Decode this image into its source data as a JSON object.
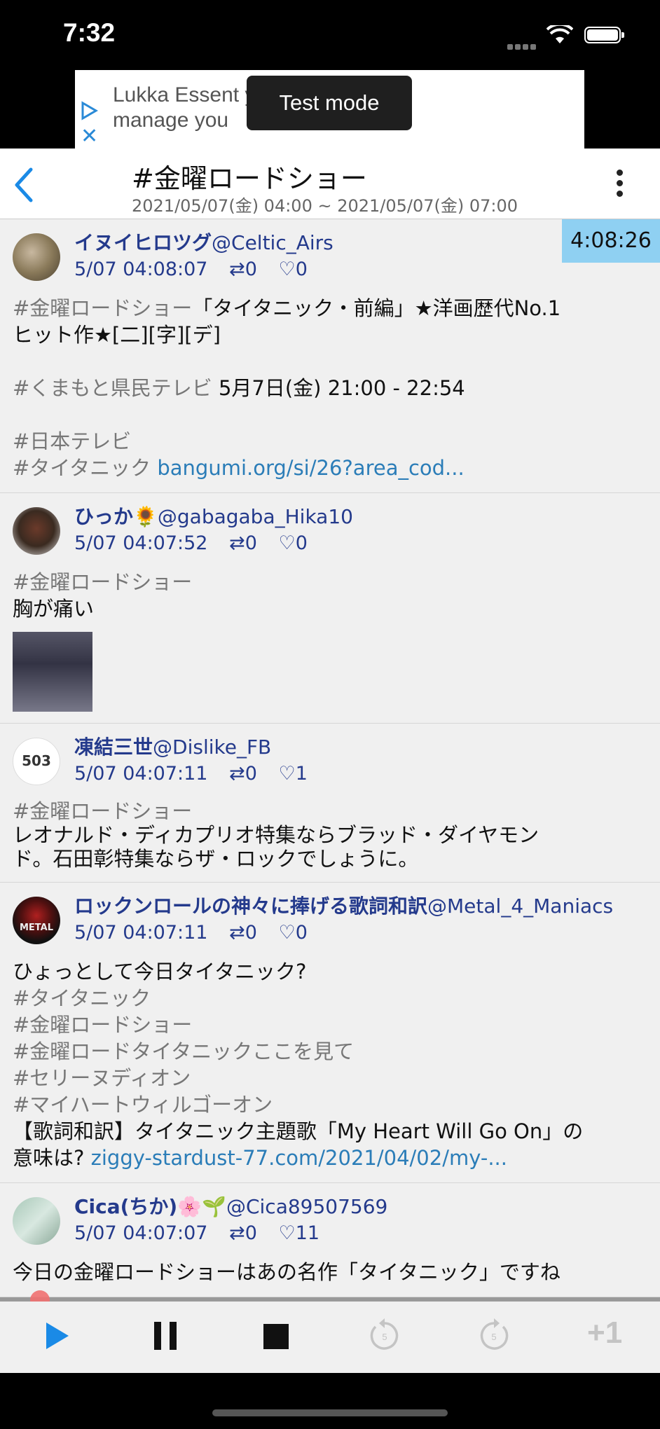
{
  "status": {
    "time": "7:32"
  },
  "ad": {
    "text": "Lukka Essent           you need to\nmanage you",
    "test_mode": "Test mode"
  },
  "header": {
    "title": "#金曜ロードショー",
    "subtitle": "2021/05/07(金) 04:00 ~ 2021/05/07(金) 07:00"
  },
  "elapsed": "4:08:26",
  "tweets": [
    {
      "name": "イヌイヒロツグ",
      "handle": "@Celtic_Airs",
      "time": "5/07 04:08:07",
      "retweets": "0",
      "likes": "0",
      "lines": [
        "#金曜ロードショー「タイタニック・前編」★洋画歴代No.1",
        "ヒット作★[二][字][デ]",
        "",
        "#くまもと県民テレビ 5月7日(金) 21:00 - 22:54",
        "",
        "#日本テレビ",
        "#タイタニック bangumi.org/si/26?area_cod..."
      ],
      "hashtag_kumamoto": "#くまもと県民テレビ",
      "kumamoto_rest": " 5月7日(金) 21:00 - 22:54",
      "hashtag_ntv": "#日本テレビ",
      "hashtag_titanic": "#タイタニック",
      "link": "bangumi.org/si/26?area_cod..."
    },
    {
      "name": "ひっか",
      "emoji": "🌻",
      "handle": "@gabagaba_Hika10",
      "time": "5/07 04:07:52",
      "retweets": "0",
      "likes": "0",
      "hashtag": "#金曜ロードショー",
      "text": "胸が痛い"
    },
    {
      "name": "凍結三世",
      "handle": "@Dislike_FB",
      "time": "5/07 04:07:11",
      "retweets": "0",
      "likes": "1",
      "avatar_text": "503",
      "hashtag": "#金曜ロードショー",
      "text1": "レオナルド・ディカプリオ特集ならブラッド・ダイヤモン",
      "text2": "ド。石田彰特集ならザ・ロックでしょうに。"
    },
    {
      "name": "ロックンロールの神々に捧げる歌詞和訳",
      "handle": "@Metal_4_Maniacs",
      "time": "5/07 04:07:11",
      "retweets": "0",
      "likes": "0",
      "avatar_text": "METAL",
      "line1": "ひょっとして今日タイタニック?",
      "tags": [
        "#タイタニック",
        "#金曜ロードショー",
        "#金曜ロードタイタニックここを見て",
        "#セリーヌディオン",
        "#マイハートウィルゴーオン"
      ],
      "text1": "【歌詞和訳】タイタニック主題歌「My Heart Will Go On」の",
      "text2": "意味は? ",
      "link": "ziggy-stardust-77.com/2021/04/02/my-..."
    },
    {
      "name": "Cica(ちか)",
      "emoji": "🌸🌱",
      "handle": "@Cica89507569",
      "time": "5/07 04:07:07",
      "retweets": "0",
      "likes": "11",
      "text": "今日の金曜ロードショーはあの名作「タイタニック」ですね"
    }
  ],
  "playback": {
    "progress": 0.05,
    "skip_seconds": "5",
    "plus_one": "+1"
  },
  "colors": {
    "link": "#2b7db8",
    "user": "#243a8c",
    "elapsed_bg": "#8fd0f2",
    "accent": "#1a8ae6"
  }
}
